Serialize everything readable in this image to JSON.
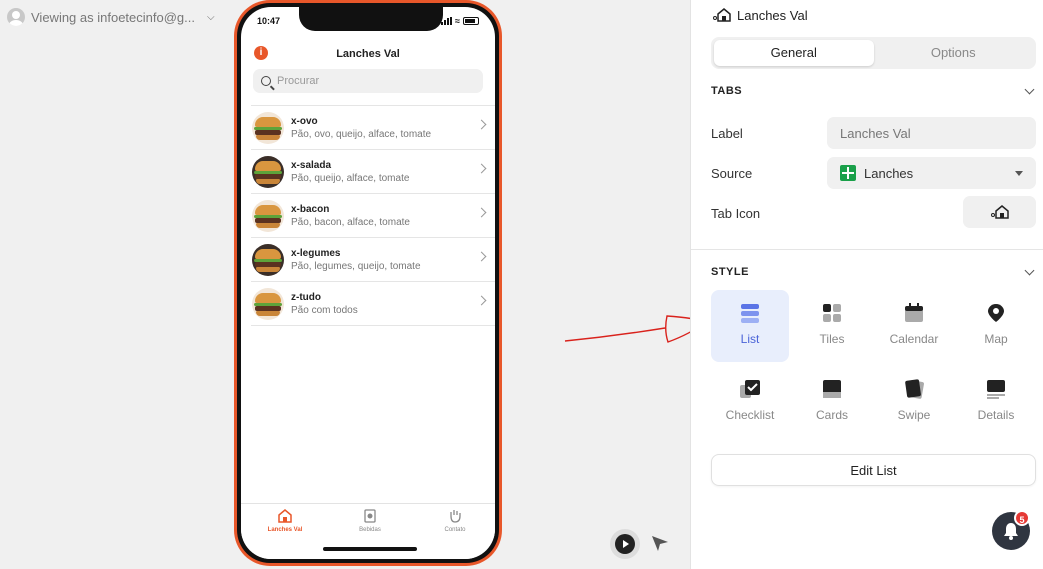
{
  "topbar": {
    "viewing_as": "Viewing as infoetecinfo@g..."
  },
  "phone": {
    "time": "10:47",
    "app_title": "Lanches Val",
    "search_placeholder": "Procurar",
    "items": [
      {
        "title": "x-ovo",
        "subtitle": "Pão, ovo, queijo, alface, tomate"
      },
      {
        "title": "x-salada",
        "subtitle": "Pão, queijo, alface, tomate"
      },
      {
        "title": "x-bacon",
        "subtitle": "Pão, bacon, alface, tomate"
      },
      {
        "title": "x-legumes",
        "subtitle": "Pão, legumes, queijo, tomate"
      },
      {
        "title": "z-tudo",
        "subtitle": "Pão com todos"
      }
    ],
    "tabs": [
      {
        "label": "Lanches Val",
        "icon": "store-icon",
        "active": true
      },
      {
        "label": "Bebidas",
        "icon": "cup-icon",
        "active": false
      },
      {
        "label": "Contato",
        "icon": "hand-icon",
        "active": false
      }
    ]
  },
  "panel": {
    "header_title": "Lanches Val",
    "segments": [
      "General",
      "Options"
    ],
    "tabs_section": "TABS",
    "label_label": "Label",
    "label_value": "Lanches Val",
    "source_label": "Source",
    "source_value": "Lanches",
    "tab_icon_label": "Tab Icon",
    "style_section": "STYLE",
    "styles": [
      "List",
      "Tiles",
      "Calendar",
      "Map",
      "Checklist",
      "Cards",
      "Swipe",
      "Details"
    ],
    "selected_style": "List",
    "edit_button": "Edit List"
  },
  "notifications": {
    "count": "5"
  },
  "colors": {
    "accent": "#e8572a",
    "selected": "#4a63d8",
    "badge": "#e53935"
  }
}
